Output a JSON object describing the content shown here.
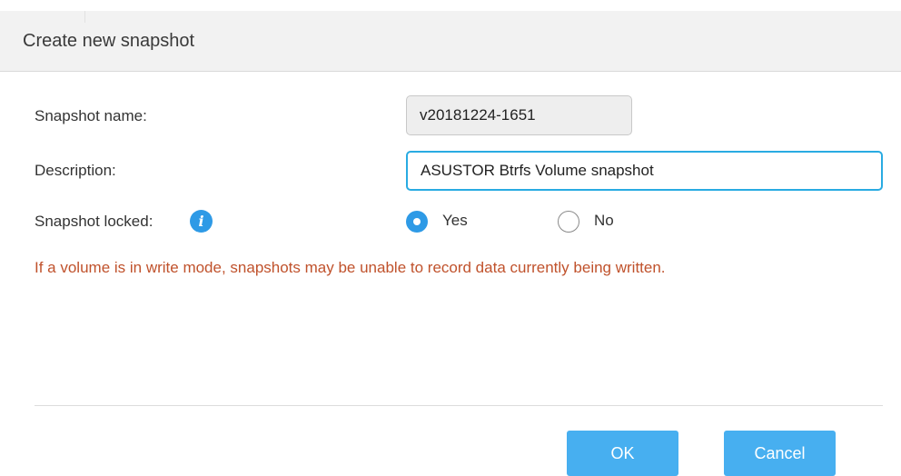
{
  "dialog": {
    "title": "Create new snapshot"
  },
  "form": {
    "snapshot_name": {
      "label": "Snapshot name:",
      "value": "v20181224-1651"
    },
    "description": {
      "label": "Description:",
      "value": "ASUSTOR Btrfs Volume snapshot"
    },
    "snapshot_locked": {
      "label": "Snapshot locked:",
      "info_icon": "info-icon",
      "options": [
        {
          "label": "Yes",
          "selected": true
        },
        {
          "label": "No",
          "selected": false
        }
      ]
    },
    "warning": "If a volume is in write mode, snapshots may be unable to record data currently being written."
  },
  "buttons": {
    "ok_label": "OK",
    "cancel_label": "Cancel"
  },
  "colors": {
    "accent": "#2e9ae6",
    "button": "#47aff0",
    "focus_border": "#29abe2",
    "warning": "#c0522c"
  }
}
